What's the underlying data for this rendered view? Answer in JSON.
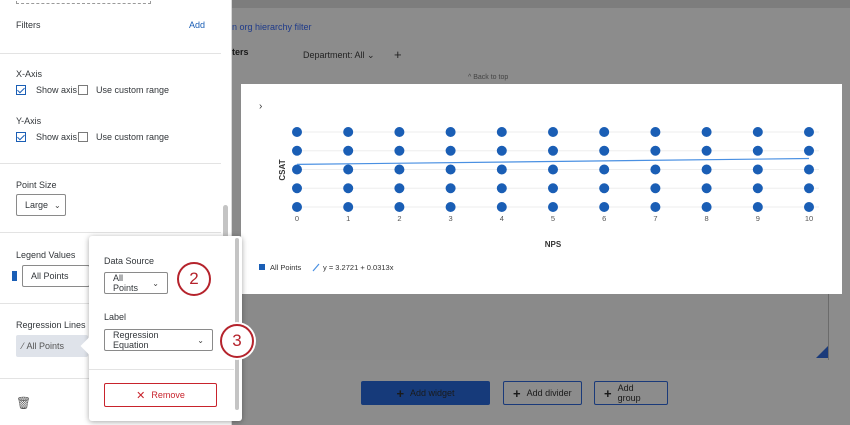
{
  "dashboard": {
    "org_filter_link": "n org hierarchy filter",
    "filter_tab": "ters",
    "department_filter": "Department: All",
    "back_to_top": "^ Back to top",
    "buttons": {
      "add_widget": "Add widget",
      "add_divider": "Add divider",
      "add_group": "Add group"
    }
  },
  "sidebar": {
    "filters_label": "Filters",
    "add_link": "Add",
    "x_axis": {
      "heading": "X-Axis",
      "show_axis": "Show axis",
      "custom_range": "Use custom range"
    },
    "y_axis": {
      "heading": "Y-Axis",
      "show_axis": "Show axis",
      "custom_range": "Use custom range"
    },
    "point_size": {
      "label": "Point Size",
      "value": "Large"
    },
    "legend_values": {
      "label": "Legend Values",
      "value": "All Points"
    },
    "regression_lines": {
      "label": "Regression Lines",
      "item": "All Points"
    }
  },
  "popover": {
    "data_source_label": "Data Source",
    "data_source_value": "All Points",
    "label_label": "Label",
    "label_value": "Regression Equation",
    "remove_label": "Remove"
  },
  "callouts": [
    "2",
    "3"
  ],
  "chart_data": {
    "type": "scatter",
    "xlabel": "NPS",
    "ylabel": "CSAT",
    "x_ticks": [
      "0",
      "1",
      "2",
      "3",
      "4",
      "5",
      "6",
      "7",
      "8",
      "9",
      "10"
    ],
    "xlim": [
      0,
      10
    ],
    "y_levels": [
      1,
      2,
      3,
      4,
      5
    ],
    "points_x": [
      0,
      1,
      2,
      3,
      4,
      5,
      6,
      7,
      8,
      9,
      10
    ],
    "regression": {
      "intercept": 3.2721,
      "slope": 0.0313,
      "label": "y = 3.2721 + 0.0313x"
    },
    "legend": {
      "series": "All Points",
      "regression": "y = 3.2721 + 0.0313x"
    },
    "colors": {
      "points": "#1a5eb5",
      "line": "#4a90e2"
    }
  }
}
